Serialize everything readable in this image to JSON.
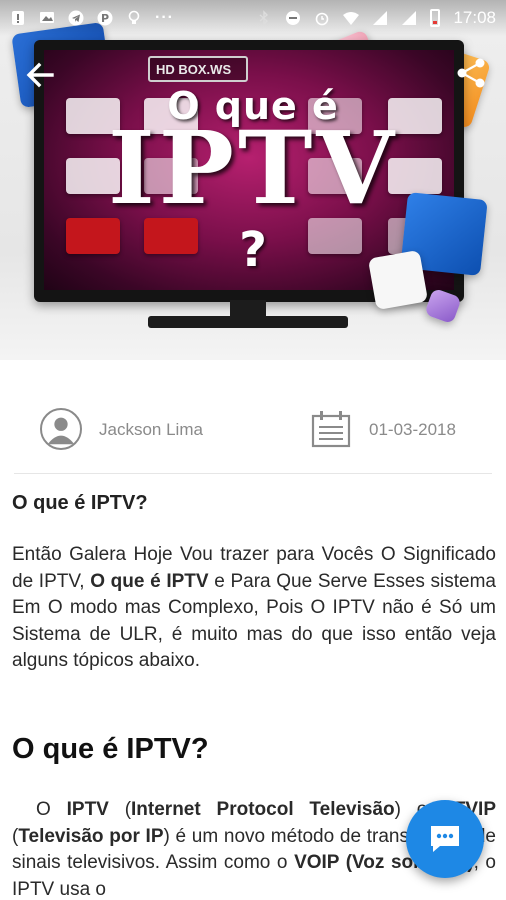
{
  "status_bar": {
    "time": "17:08",
    "icons": [
      "alert-icon",
      "gallery-icon",
      "telegram-icon",
      "pinterest-icon",
      "bulb-icon",
      "more-icon",
      "bluetooth-icon",
      "dnd-icon",
      "alarm-icon",
      "wifi-icon",
      "signal-icon",
      "signal-icon",
      "battery-icon"
    ],
    "more_dots": "···"
  },
  "hero": {
    "brand_label": "HD BOX.WS",
    "headline_line1": "O que é",
    "headline_line2": "IPTV",
    "headline_line3": "?"
  },
  "meta": {
    "author": "Jackson Lima",
    "date": "01-03-2018"
  },
  "article": {
    "heading_small": "O que é IPTV?",
    "para1": [
      {
        "text": "Então Galera Hoje Vou trazer para Vocês O Significado de IPTV, ",
        "bold": false
      },
      {
        "text": "O que é IPTV",
        "bold": true
      },
      {
        "text": " e Para Que Serve Esses sistema Em O modo mas Complexo, Pois O IPTV não é Só um Sistema de ULR, é muito mas do que isso então veja alguns tópicos abaixo.",
        "bold": false
      }
    ],
    "heading_large": "O que é IPTV?",
    "para2": [
      {
        "text": "O ",
        "bold": false
      },
      {
        "text": "IPTV",
        "bold": true
      },
      {
        "text": " (",
        "bold": false
      },
      {
        "text": "Internet Protocol Televisão",
        "bold": true
      },
      {
        "text": ") ou ",
        "bold": false
      },
      {
        "text": "TVIP",
        "bold": true
      },
      {
        "text": " (",
        "bold": false
      },
      {
        "text": "Televisão por IP",
        "bold": true
      },
      {
        "text": ") é um novo método de transmissão de sinais televisivos. Assim como o ",
        "bold": false
      },
      {
        "text": "VOIP (Voz sobre IP)",
        "bold": true
      },
      {
        "text": ", o IPTV usa o",
        "bold": false
      }
    ]
  },
  "colors": {
    "fab": "#1e88e5",
    "meta_text": "#8a8a8a"
  }
}
